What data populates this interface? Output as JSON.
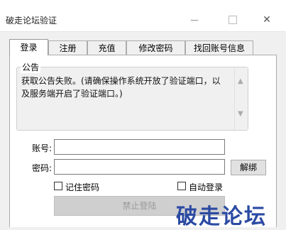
{
  "window": {
    "title": "破走论坛验证",
    "close_symbol": "✕",
    "min_symbol": "—"
  },
  "tabs": [
    {
      "label": "登录",
      "active": true
    },
    {
      "label": "注册",
      "active": false
    },
    {
      "label": "充值",
      "active": false
    },
    {
      "label": "修改密码",
      "active": false
    },
    {
      "label": "找回账号信息",
      "active": false
    }
  ],
  "announcement": {
    "legend": "公告",
    "text": "获取公告失败。(请确保操作系统开放了验证端口，以及服务端开启了验证端口。)"
  },
  "form": {
    "account_label": "账号:",
    "account_value": "",
    "password_label": "密码:",
    "password_value": "",
    "unbind_label": "解绑",
    "remember_password_label": "记住密码",
    "auto_login_label": "自动登录",
    "login_button_label": "禁止登陆"
  },
  "brand_text": "破走论坛"
}
